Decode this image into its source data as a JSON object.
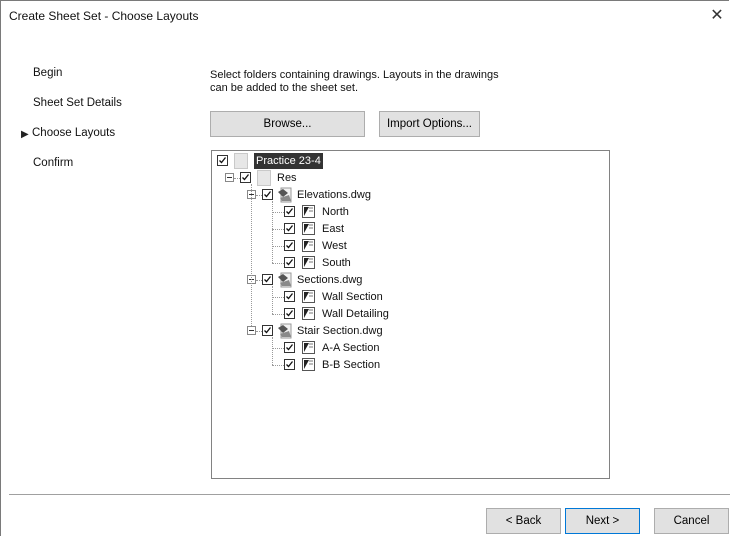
{
  "window": {
    "title": "Create Sheet Set - Choose Layouts",
    "close_glyph": "✕"
  },
  "steps": [
    {
      "label": "Begin",
      "active": false
    },
    {
      "label": "Sheet Set Details",
      "active": false
    },
    {
      "label": "Choose Layouts",
      "active": true
    },
    {
      "label": "Confirm",
      "active": false
    }
  ],
  "instruction": "Select folders containing drawings.  Layouts in the drawings can be added to the sheet set.",
  "buttons": {
    "browse": "Browse...",
    "import_options": "Import Options...",
    "back": "< Back",
    "next": "Next >",
    "cancel": "Cancel"
  },
  "tree": {
    "root": {
      "label": "Practice 23-4",
      "checked": true,
      "selected": true
    },
    "folder": {
      "label": "Res",
      "checked": true
    },
    "drawings": [
      {
        "label": "Elevations.dwg",
        "checked": true,
        "layouts": [
          {
            "label": "North",
            "checked": true
          },
          {
            "label": "East",
            "checked": true
          },
          {
            "label": "West",
            "checked": true
          },
          {
            "label": "South",
            "checked": true
          }
        ]
      },
      {
        "label": "Sections.dwg",
        "checked": true,
        "layouts": [
          {
            "label": "Wall Section",
            "checked": true
          },
          {
            "label": "Wall Detailing",
            "checked": true
          }
        ]
      },
      {
        "label": "Stair Section.dwg",
        "checked": true,
        "layouts": [
          {
            "label": "A-A Section",
            "checked": true
          },
          {
            "label": "B-B Section",
            "checked": true
          }
        ]
      }
    ]
  },
  "icons": {
    "current_step": "play-arrow-icon",
    "checkbox": "checkbox-checked-icon",
    "collapse": "collapse-minus-icon",
    "folder": "folder-icon",
    "drawing": "dwg-file-icon",
    "layout": "layout-sheet-icon"
  }
}
